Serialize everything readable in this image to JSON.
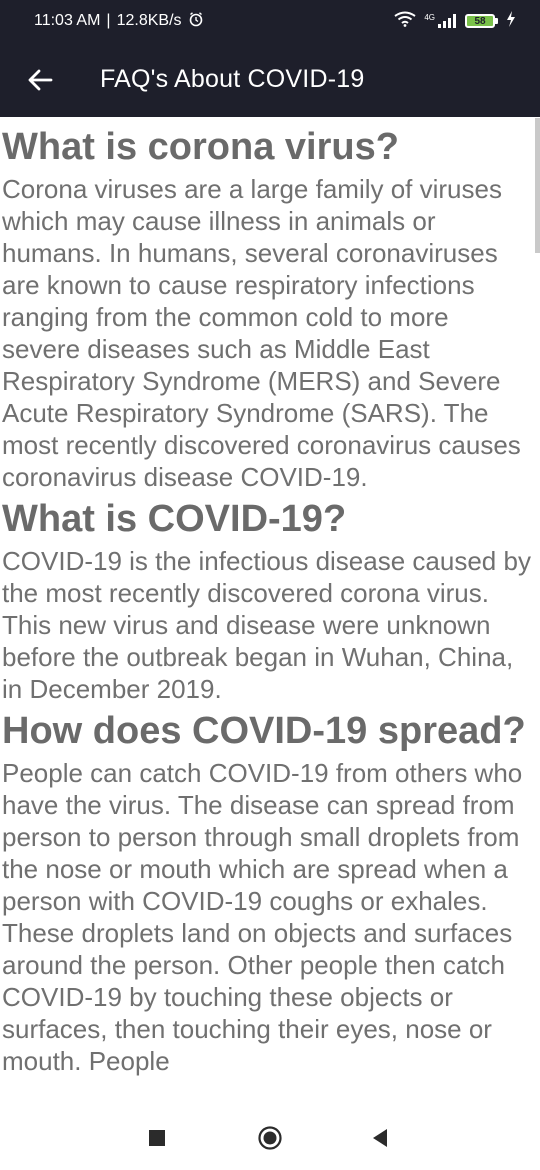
{
  "status_bar": {
    "time": "11:03 AM",
    "separator": "|",
    "speed": "12.8KB/s",
    "network": "4G",
    "battery": "58"
  },
  "app_bar": {
    "title": "FAQ's About COVID-19",
    "background": "#1e1f2b"
  },
  "faqs": [
    {
      "question": "What is corona virus?",
      "answer": "Corona viruses are a large family of viruses which may cause illness in animals or humans. In humans, several coronaviruses are known to cause respiratory infections ranging from the common cold to more severe diseases such as Middle East Respiratory Syndrome (MERS) and Severe Acute Respiratory Syndrome (SARS). The most recently discovered coronavirus causes coronavirus disease COVID-19."
    },
    {
      "question": "What is COVID-19?",
      "answer": "COVID-19 is the infectious disease caused by the most recently discovered corona virus. This new virus and disease were unknown before the outbreak began in Wuhan, China, in December 2019."
    },
    {
      "question": "How does COVID-19 spread?",
      "answer": "People can catch COVID-19 from others who have the virus. The disease can spread from person to person through small droplets from the nose or mouth which are spread when a person with COVID-19 coughs or exhales. These droplets land on objects and surfaces around the person. Other people then catch COVID-19 by touching these objects or surfaces, then touching their eyes, nose or mouth. People"
    }
  ],
  "nav_bar": {
    "icons": [
      "recent-apps-icon",
      "home-icon",
      "back-icon"
    ]
  }
}
